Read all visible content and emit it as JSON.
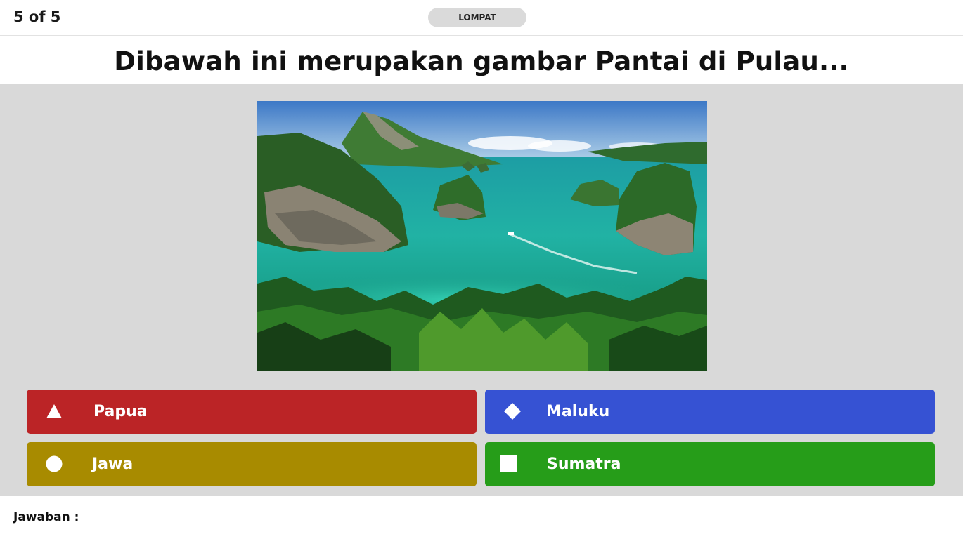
{
  "header": {
    "counter": "5 of 5",
    "skip_label": "LOMPAT"
  },
  "question": {
    "text": "Dibawah ini merupakan gambar Pantai di Pulau..."
  },
  "image": {
    "icon": "island-beach-photo"
  },
  "answers": [
    {
      "label": "Papua",
      "shape": "triangle-icon",
      "color": "#bb2426"
    },
    {
      "label": "Maluku",
      "shape": "diamond-icon",
      "color": "#3652d3"
    },
    {
      "label": "Jawa",
      "shape": "circle-icon",
      "color": "#a88b00"
    },
    {
      "label": "Sumatra",
      "shape": "square-icon",
      "color": "#269d19"
    }
  ],
  "footer": {
    "answer_label": "Jawaban :"
  }
}
